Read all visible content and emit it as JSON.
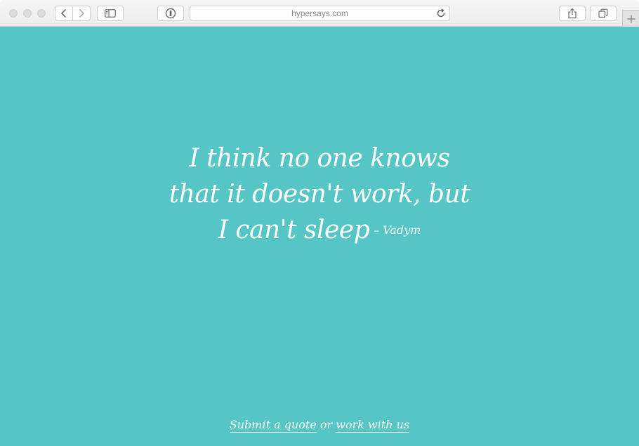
{
  "browser": {
    "address": "hypersays.com",
    "icons": {
      "back": "chevron-left-icon",
      "forward": "chevron-right-icon",
      "sidebar": "sidebar-icon",
      "privacy": "privacy-report-icon",
      "reload": "reload-icon",
      "share": "share-icon",
      "tabs": "tab-overview-icon",
      "new_tab": "plus-icon"
    }
  },
  "page": {
    "background_color": "#55c6c5",
    "text_color": "#ffffff",
    "quote": {
      "line1": "I think no one knows",
      "line2": "that it doesn't work, but",
      "line3": "I can't sleep",
      "author": "– Vadym"
    },
    "footer": {
      "submit_link": "Submit a quote",
      "connector": "or",
      "work_link": "work with us"
    }
  }
}
